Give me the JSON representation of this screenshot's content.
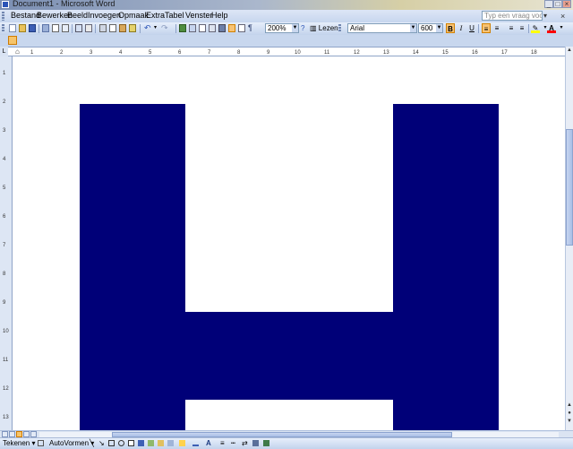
{
  "window": {
    "title": "Document1 - Microsoft Word"
  },
  "menu": {
    "items": [
      "Bestand",
      "Bewerken",
      "Beeld",
      "Invoegen",
      "Opmaak",
      "Extra",
      "Tabel",
      "Venster",
      "Help"
    ],
    "help_placeholder": "Typ een vraag voor hulp"
  },
  "toolbar": {
    "zoom": "200%",
    "read_label": "Lezen",
    "font_name": "Arial",
    "font_size": "600",
    "bold": "B",
    "italic": "I",
    "underline": "U",
    "highlight_color": "#ffff00",
    "font_color": "#ff0000"
  },
  "drawing_toolbar": {
    "draw_label": "Tekenen",
    "autoshapes_label": "AutoVormen"
  },
  "document": {
    "glyph_color": "#000078"
  },
  "ruler": {
    "h_ticks": [
      "1",
      "2",
      "3",
      "4",
      "5",
      "6",
      "7",
      "8",
      "9",
      "10",
      "11",
      "12",
      "13",
      "14",
      "15",
      "16",
      "17",
      "18"
    ],
    "v_ticks": [
      "1",
      "2",
      "3",
      "4",
      "5",
      "6",
      "7",
      "8",
      "9",
      "10",
      "11",
      "12",
      "13"
    ]
  }
}
